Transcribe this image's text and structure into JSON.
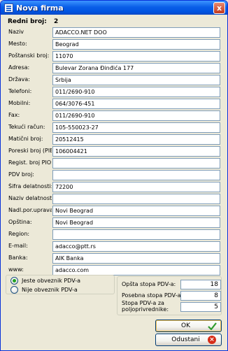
{
  "window": {
    "title": "Nova firma",
    "close_glyph": "x"
  },
  "header": {
    "label": "Redni broj:",
    "value": "2"
  },
  "fields": [
    {
      "label": "Naziv",
      "value": "ADACCO.NET DOO"
    },
    {
      "label": "Mesto:",
      "value": "Beograd"
    },
    {
      "label": "Poštanski broj:",
      "value": "11070"
    },
    {
      "label": "Adresa:",
      "value": "Bulevar Zorana Đinđića 177"
    },
    {
      "label": "Država:",
      "value": "Srbija"
    },
    {
      "label": "Telefoni:",
      "value": "011/2690-910"
    },
    {
      "label": "Mobilni:",
      "value": "064/3076-451"
    },
    {
      "label": "Fax:",
      "value": "011/2690-910"
    },
    {
      "label": "Tekući račun:",
      "value": "105-550023-27"
    },
    {
      "label": "Matični broj:",
      "value": "20512415"
    },
    {
      "label": "Poreski broj (PIB):",
      "value": "106004421"
    },
    {
      "label": "Regist. broj PIO:",
      "value": ""
    },
    {
      "label": "PDV broj:",
      "value": ""
    },
    {
      "label": "Šifra delatnosti:",
      "value": "72200"
    },
    {
      "label": "Naziv delatnosti:",
      "value": ""
    },
    {
      "label": "Nadl.por.uprava:",
      "value": "Novi Beograd"
    },
    {
      "label": "Opština:",
      "value": "Novi Beograd"
    },
    {
      "label": "Region:",
      "value": ""
    },
    {
      "label": "E-mail:",
      "value": "adacco@ptt.rs"
    },
    {
      "label": "Banka:",
      "value": "AIK Banka"
    },
    {
      "label": "www:",
      "value": "adacco.com"
    }
  ],
  "pdv_status": {
    "options": [
      {
        "label": "Jeste obveznik PDV-a",
        "checked": true
      },
      {
        "label": "Nije obveznik PDV-a",
        "checked": false
      }
    ]
  },
  "pdv_rates": [
    {
      "label": "Opšta stopa PDV-a:",
      "value": "18"
    },
    {
      "label": "Posebna stopa PDV-a:",
      "value": "8"
    },
    {
      "label": "Stopa PDV-a za poljoprivrednike:",
      "value": "5"
    }
  ],
  "buttons": {
    "ok_label": "OK",
    "ok_icon": "checkmark-icon",
    "cancel_label": "Odustani",
    "cancel_icon": "cancel-icon"
  },
  "colors": {
    "titlebar": "#0a5fe8",
    "ok_check": "#2e9b2e",
    "cancel_red": "#d62c17"
  }
}
